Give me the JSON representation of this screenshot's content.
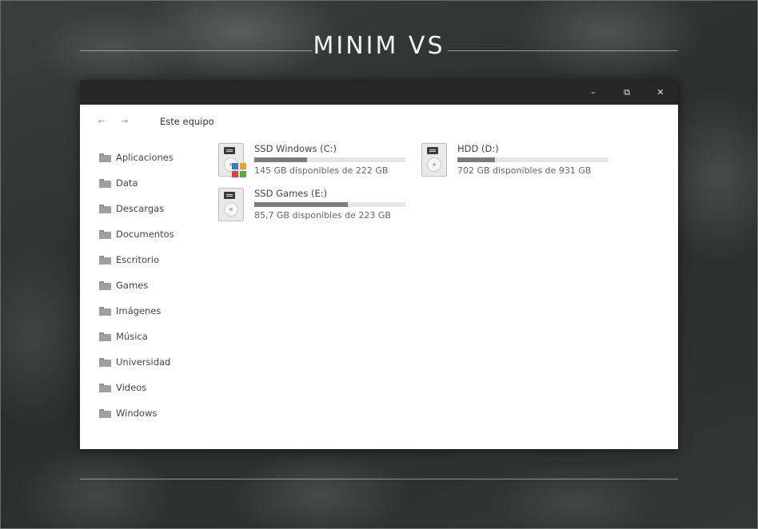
{
  "banner": {
    "title": "MINIM VS"
  },
  "window": {
    "controls": {
      "minimize": "–",
      "maximize": "⧉",
      "close": "✕"
    },
    "nav": {
      "back": "←",
      "forward": "→"
    },
    "breadcrumb": "Este equipo"
  },
  "sidebar": {
    "items": [
      {
        "label": "Aplicaciones"
      },
      {
        "label": "Data"
      },
      {
        "label": "Descargas"
      },
      {
        "label": "Documentos"
      },
      {
        "label": "Escritorio"
      },
      {
        "label": "Games"
      },
      {
        "label": "Imágenes"
      },
      {
        "label": "Música"
      },
      {
        "label": "Universidad"
      },
      {
        "label": "Videos"
      },
      {
        "label": "Windows"
      }
    ]
  },
  "drives": [
    {
      "name": "SSD Windows (C:)",
      "free": "145 GB disponibles de 222 GB",
      "used_fraction": 0.35,
      "icon": "windows-drive-icon"
    },
    {
      "name": "HDD (D:)",
      "free": "702 GB disponibles de 931 GB",
      "used_fraction": 0.25,
      "icon": "hard-drive-icon"
    },
    {
      "name": "SSD Games (E:)",
      "free": "85,7 GB disponibles de 223 GB",
      "used_fraction": 0.62,
      "icon": "hard-drive-icon"
    }
  ],
  "colors": {
    "titlebar": "#262626",
    "usage_bar": "#7b7b7b",
    "usage_track": "#e6e6e6",
    "win_logo": [
      "#3b7ac9",
      "#e6a13a",
      "#d64a3a",
      "#5aa84a"
    ]
  }
}
